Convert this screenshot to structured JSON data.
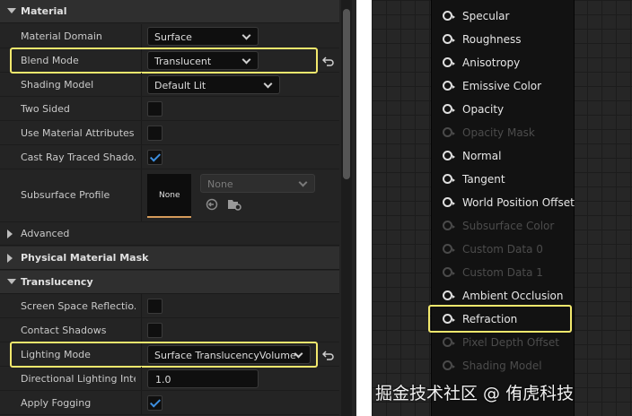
{
  "details": {
    "material_section": "Material",
    "material_domain": {
      "label": "Material Domain",
      "value": "Surface"
    },
    "blend_mode": {
      "label": "Blend Mode",
      "value": "Translucent"
    },
    "shading_model": {
      "label": "Shading Model",
      "value": "Default Lit"
    },
    "two_sided": {
      "label": "Two Sided",
      "checked": false
    },
    "use_material_attributes": {
      "label": "Use Material Attributes",
      "checked": false
    },
    "cast_ray_traced_shadows": {
      "label": "Cast Ray Traced Shado...",
      "checked": true
    },
    "subsurface_profile": {
      "label": "Subsurface Profile",
      "thumb_label": "None",
      "value": "None"
    },
    "advanced_label": "Advanced",
    "physical_material_mask_section": "Physical Material Mask",
    "translucency_section": "Translucency",
    "screen_space_reflections": {
      "label": "Screen Space Reflectio...",
      "checked": false
    },
    "contact_shadows": {
      "label": "Contact Shadows",
      "checked": false
    },
    "lighting_mode": {
      "label": "Lighting Mode",
      "value": "Surface TranslucencyVolume"
    },
    "directional_lighting_intensity": {
      "label": "Directional Lighting Inte...",
      "value": "1.0"
    },
    "apply_fogging": {
      "label": "Apply Fogging",
      "checked": true
    }
  },
  "node_pins": [
    {
      "label": "Specular",
      "enabled": true
    },
    {
      "label": "Roughness",
      "enabled": true
    },
    {
      "label": "Anisotropy",
      "enabled": true
    },
    {
      "label": "Emissive Color",
      "enabled": true
    },
    {
      "label": "Opacity",
      "enabled": true
    },
    {
      "label": "Opacity Mask",
      "enabled": false
    },
    {
      "label": "Normal",
      "enabled": true
    },
    {
      "label": "Tangent",
      "enabled": true
    },
    {
      "label": "World Position Offset",
      "enabled": true
    },
    {
      "label": "Subsurface Color",
      "enabled": false
    },
    {
      "label": "Custom Data 0",
      "enabled": false
    },
    {
      "label": "Custom Data 1",
      "enabled": false
    },
    {
      "label": "Ambient Occlusion",
      "enabled": true
    },
    {
      "label": "Refraction",
      "enabled": true
    },
    {
      "label": "Pixel Depth Offset",
      "enabled": false
    },
    {
      "label": "Shading Model",
      "enabled": false
    }
  ],
  "watermark": "掘金技术社区 @ 侑虎科技",
  "colors": {
    "highlight": "#f2e86d",
    "check": "#3d8fe0",
    "panel": "#242424"
  }
}
